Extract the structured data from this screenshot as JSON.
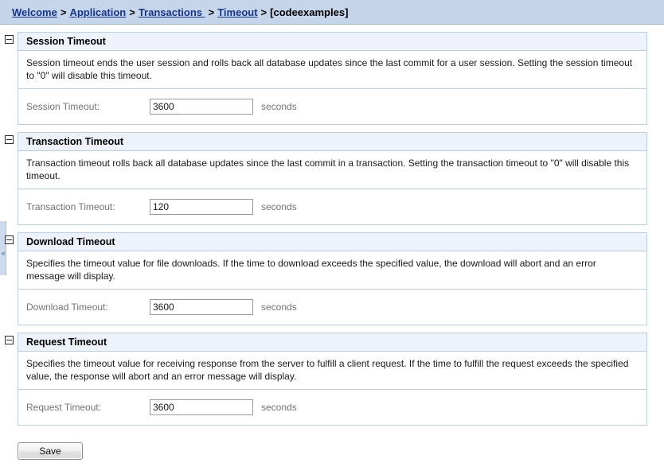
{
  "breadcrumb": {
    "separator": ">",
    "links": [
      {
        "label": "Welcome"
      },
      {
        "label": "Application"
      },
      {
        "label": "Transactions "
      },
      {
        "label": "Timeout"
      }
    ],
    "current": "[codeexamples]"
  },
  "icons": {
    "collapse": "collapse-minus-icon",
    "splitter_arrow": "«"
  },
  "sections": [
    {
      "title": "Session Timeout",
      "description": "Session timeout ends the user session and rolls back all database updates since the last commit for a user session. Setting the session timeout to \"0\" will disable this timeout.",
      "field_label": "Session Timeout:",
      "field_value": "3600",
      "field_unit": "seconds"
    },
    {
      "title": "Transaction Timeout",
      "description": "Transaction timeout rolls back all database updates since the last commit in a transaction. Setting the transaction timeout to \"0\" will disable this timeout.",
      "field_label": "Transaction Timeout:",
      "field_value": "120",
      "field_unit": "seconds"
    },
    {
      "title": "Download Timeout",
      "description": "Specifies the timeout value for file downloads. If the time to download exceeds the specified value, the download will abort and an error message will display.",
      "field_label": "Download Timeout:",
      "field_value": "3600",
      "field_unit": "seconds"
    },
    {
      "title": "Request Timeout",
      "description": "Specifies the timeout value for receiving response from the server to fulfill a client request. If the time to fulfill the request exceeds the specified value, the response will abort and an error message will display.",
      "field_label": "Request Timeout:",
      "field_value": "3600",
      "field_unit": "seconds"
    }
  ],
  "actions": {
    "save_label": "Save"
  },
  "colors": {
    "header_bar": "#c5d5ea",
    "link": "#16348c",
    "panel_border": "#b9cde3",
    "panel_header_bg": "#eef3fb",
    "label_text": "#737373"
  }
}
